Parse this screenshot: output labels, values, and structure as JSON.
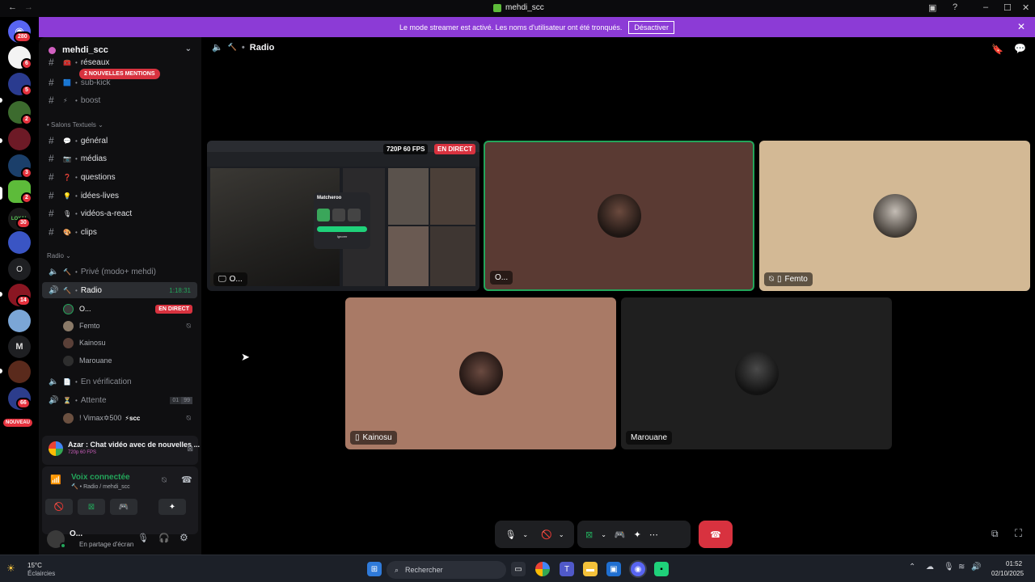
{
  "window": {
    "title": "mehdi_scc"
  },
  "rail": {
    "badges": [
      "280",
      "6",
      "5",
      "2",
      "2",
      "3",
      "2",
      "30",
      "14",
      "66"
    ],
    "letters": [
      "O",
      "M"
    ],
    "new_label": "NOUVEAU"
  },
  "banner": {
    "text": "Le mode streamer est activé. Les noms d'utilisateur ont été tronqués.",
    "button": "Désactiver",
    "color": "#8c3bd6"
  },
  "sidebar": {
    "guild": "mehdi_scc",
    "mentions_pill": "2 NOUVELLES MENTIONS",
    "top_channels": [
      {
        "name": "réseaux",
        "emoji": "🧰"
      },
      {
        "name": "sub-kick",
        "emoji": "🟦"
      },
      {
        "name": "boost",
        "emoji": "⚡"
      }
    ],
    "text_category": "Salons Textuels",
    "text_channels": [
      {
        "name": "général",
        "emoji": "💬"
      },
      {
        "name": "médias",
        "emoji": "📷"
      },
      {
        "name": "questions",
        "emoji": "❓"
      },
      {
        "name": "idées-lives",
        "emoji": "💡"
      },
      {
        "name": "vidéos-a-react",
        "emoji": "🎙"
      },
      {
        "name": "clips",
        "emoji": "🎨"
      }
    ],
    "voice_category": "Radio",
    "voice_channels": {
      "prive": "Privé (modo+ mehdi)",
      "radio": "Radio",
      "radio_timer": "1:18:31",
      "users": [
        {
          "name": "O...",
          "live": "EN DIRECT"
        },
        {
          "name": "Femto"
        },
        {
          "name": "Kainosu"
        },
        {
          "name": "Marouane"
        }
      ],
      "verification": "En vérification",
      "attente": "Attente",
      "attente_count_a": "01",
      "attente_count_b": "99",
      "attente_user": "! Vimax✡500",
      "attente_user_tag": "scc"
    }
  },
  "activity": {
    "title": "Azar : Chat vidéo avec de nouvelles ...",
    "sub": "720p 60 FPS"
  },
  "voice_panel": {
    "status": "Voix connectée",
    "channel": "Radio / mehdi_scc"
  },
  "user_panel": {
    "name": "O...",
    "status": "En partage d'écran"
  },
  "main": {
    "channel": "Radio",
    "stream_badge": "720P 60 FPS",
    "live_badge": "EN DIRECT",
    "tiles": [
      {
        "name": "O..."
      },
      {
        "name": "O..."
      },
      {
        "name": "Femto"
      },
      {
        "name": "Kainosu"
      },
      {
        "name": "Marouane"
      }
    ],
    "stream_popup_title": "Matcheroo",
    "stream_popup_btn": "Ignorer"
  },
  "taskbar": {
    "weather_temp": "15°C",
    "weather_desc": "Éclaircies",
    "search": "Rechercher",
    "time": "01:52",
    "date": "02/10/2025"
  }
}
